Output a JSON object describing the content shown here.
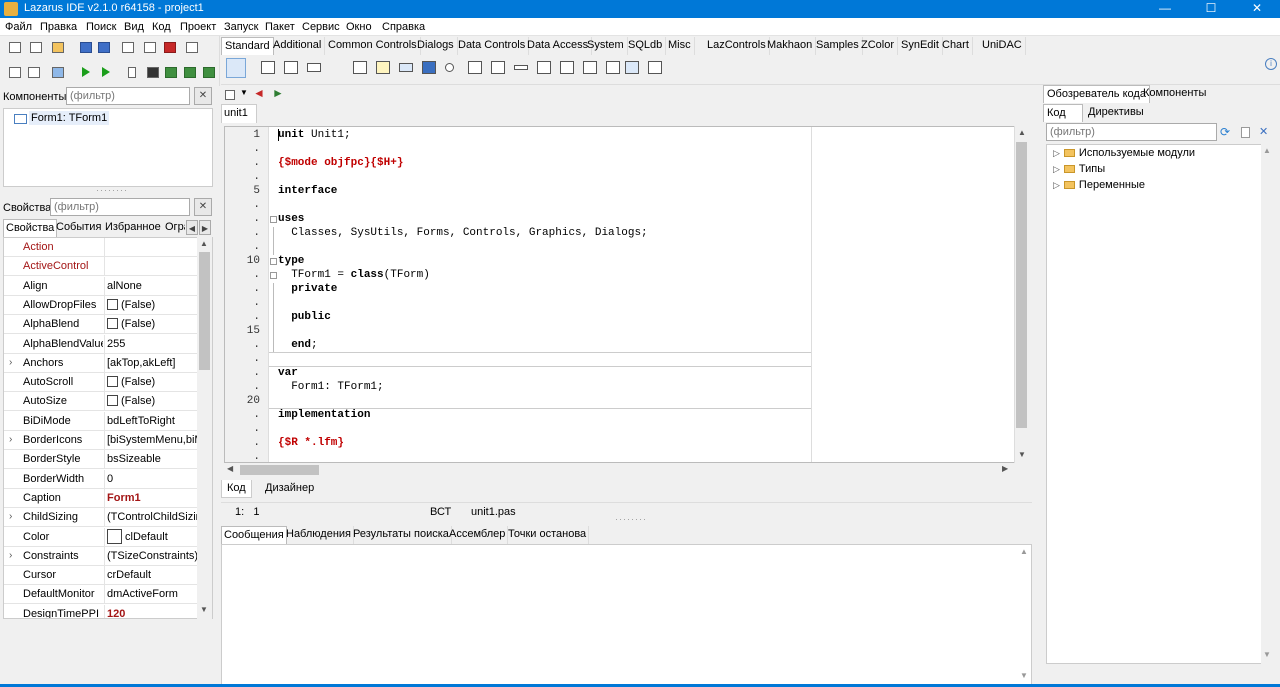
{
  "window": {
    "title": "Lazarus IDE v2.1.0 r64158 - project1",
    "controls": [
      "—",
      "☐",
      "✕"
    ]
  },
  "menu": [
    "Файл",
    "Правка",
    "Поиск",
    "Вид",
    "Код",
    "Проект",
    "Запуск",
    "Пакет",
    "Сервис",
    "Окно",
    "Справка"
  ],
  "palette": {
    "tabs": [
      "Standard",
      "Additional",
      "Common Controls",
      "Dialogs",
      "Data Controls",
      "Data Access",
      "System",
      "SQLdb",
      "Misc",
      "LazControls",
      "Makhaon",
      "Samples",
      "ZColor",
      "SynEdit",
      "Chart",
      "UniDAC"
    ],
    "active_tab": "Standard"
  },
  "components_panel": {
    "label": "Компоненты",
    "filter_placeholder": "(фильтр)",
    "tree_item": "Form1: TForm1"
  },
  "properties_panel": {
    "label": "Свойства",
    "filter_placeholder": "(фильтр)",
    "tabs": [
      "Свойства",
      "События",
      "Избранное",
      "Огра"
    ],
    "rows": [
      {
        "name": "Action",
        "value": "",
        "red": true
      },
      {
        "name": "ActiveControl",
        "value": "",
        "red": true
      },
      {
        "name": "Align",
        "value": "alNone"
      },
      {
        "name": "AllowDropFiles",
        "value": "(False)",
        "checkbox": true
      },
      {
        "name": "AlphaBlend",
        "value": "(False)",
        "checkbox": true
      },
      {
        "name": "AlphaBlendValue",
        "value": "255"
      },
      {
        "name": "Anchors",
        "value": "[akTop,akLeft]",
        "expand": true
      },
      {
        "name": "AutoScroll",
        "value": "(False)",
        "checkbox": true
      },
      {
        "name": "AutoSize",
        "value": "(False)",
        "checkbox": true
      },
      {
        "name": "BiDiMode",
        "value": "bdLeftToRight"
      },
      {
        "name": "BorderIcons",
        "value": "[biSystemMenu,biMi",
        "expand": true
      },
      {
        "name": "BorderStyle",
        "value": "bsSizeable"
      },
      {
        "name": "BorderWidth",
        "value": "0"
      },
      {
        "name": "Caption",
        "value": "Form1",
        "bold": true
      },
      {
        "name": "ChildSizing",
        "value": "(TControlChildSizing)",
        "expand": true
      },
      {
        "name": "Color",
        "value": "clDefault",
        "colorbox": true
      },
      {
        "name": "Constraints",
        "value": "(TSizeConstraints)",
        "expand": true
      },
      {
        "name": "Cursor",
        "value": "crDefault"
      },
      {
        "name": "DefaultMonitor",
        "value": "dmActiveForm"
      },
      {
        "name": "DesignTimePPI",
        "value": "120",
        "bold": true
      }
    ]
  },
  "editor": {
    "tab": "unit1",
    "gutter": [
      {
        "text": "1"
      },
      {
        "text": "."
      },
      {
        "text": "."
      },
      {
        "text": "."
      },
      {
        "text": "5"
      },
      {
        "text": "."
      },
      {
        "text": "."
      },
      {
        "text": "."
      },
      {
        "text": "."
      },
      {
        "text": "10"
      },
      {
        "text": "."
      },
      {
        "text": "."
      },
      {
        "text": "."
      },
      {
        "text": "."
      },
      {
        "text": "15"
      },
      {
        "text": "."
      },
      {
        "text": "."
      },
      {
        "text": "."
      },
      {
        "text": "."
      },
      {
        "text": "20"
      },
      {
        "text": "."
      },
      {
        "text": "."
      },
      {
        "text": "."
      },
      {
        "text": "."
      }
    ],
    "lines": [
      {
        "segments": [
          {
            "t": "unit",
            "c": "kw"
          },
          {
            "t": " Unit1;"
          }
        ]
      },
      {
        "segments": []
      },
      {
        "segments": [
          {
            "t": "{$mode objfpc}{$H+}",
            "c": "dir"
          }
        ]
      },
      {
        "segments": []
      },
      {
        "segments": [
          {
            "t": "interface",
            "c": "kw"
          }
        ]
      },
      {
        "segments": []
      },
      {
        "segments": [
          {
            "t": "uses",
            "c": "kw"
          }
        ]
      },
      {
        "segments": [
          {
            "t": "  Classes, SysUtils, Forms, Controls, Graphics, Dialogs;"
          }
        ]
      },
      {
        "segments": []
      },
      {
        "segments": [
          {
            "t": "type",
            "c": "kw"
          }
        ]
      },
      {
        "segments": [
          {
            "t": "  TForm1 = "
          },
          {
            "t": "class",
            "c": "kw"
          },
          {
            "t": "(TForm)"
          }
        ]
      },
      {
        "segments": [
          {
            "t": "  "
          },
          {
            "t": "private",
            "c": "kw"
          }
        ]
      },
      {
        "segments": []
      },
      {
        "segments": [
          {
            "t": "  "
          },
          {
            "t": "public",
            "c": "kw"
          }
        ]
      },
      {
        "segments": []
      },
      {
        "segments": [
          {
            "t": "  "
          },
          {
            "t": "end",
            "c": "kw"
          },
          {
            "t": ";"
          }
        ]
      },
      {
        "segments": []
      },
      {
        "segments": [
          {
            "t": "var",
            "c": "kw"
          }
        ]
      },
      {
        "segments": [
          {
            "t": "  Form1: TForm1;"
          }
        ]
      },
      {
        "segments": []
      },
      {
        "segments": [
          {
            "t": "implementation",
            "c": "kw"
          }
        ]
      },
      {
        "segments": []
      },
      {
        "segments": [
          {
            "t": "{$R *.lfm}",
            "c": "dir"
          }
        ]
      },
      {
        "segments": []
      }
    ],
    "bottom_tabs": [
      "Код",
      "Дизайнер"
    ],
    "status": {
      "position": "1:   1",
      "mode": "ВСТ",
      "file": "unit1.pas"
    }
  },
  "messages": {
    "tabs": [
      "Сообщения",
      "Наблюдения",
      "Результаты поиска",
      "Ассемблер",
      "Точки останова"
    ]
  },
  "code_explorer": {
    "tabs": [
      "Обозреватель кода",
      "Компоненты"
    ],
    "subtabs": [
      "Код",
      "Директивы"
    ],
    "filter_placeholder": "(фильтр)",
    "tree": [
      "Используемые модули",
      "Типы",
      "Переменные"
    ]
  },
  "colors": {
    "titlebar": "#0078d7",
    "keyword": "#000000",
    "directive": "#c00000",
    "prop_red": "#a31515"
  }
}
